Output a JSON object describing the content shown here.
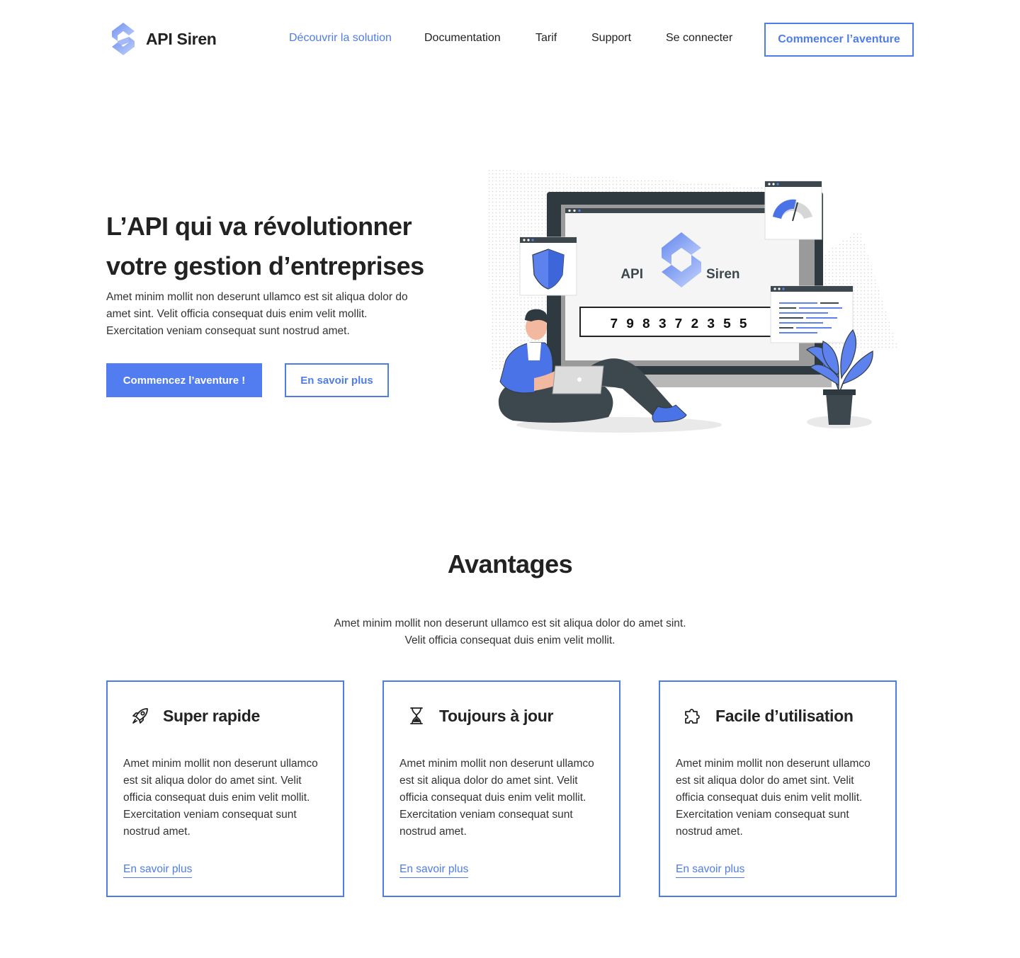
{
  "brand": {
    "name": "API Siren"
  },
  "nav": {
    "items": [
      {
        "label": "Découvrir la solution",
        "active": true
      },
      {
        "label": "Documentation"
      },
      {
        "label": "Tarif"
      },
      {
        "label": "Support"
      },
      {
        "label": "Se connecter"
      }
    ],
    "cta": "Commencer l’aventure"
  },
  "hero": {
    "title_line1": "L’API qui va révolutionner",
    "title_line2": "votre gestion d’entreprises",
    "description": "Amet minim mollit non deserunt ullamco est sit aliqua dolor do amet sint. Velit officia consequat duis enim velit mollit. Exercitation veniam consequat sunt nostrud amet.",
    "primary_button": "Commencez l’aventure !",
    "secondary_button": "En savoir plus",
    "illustration": {
      "screen_logo_left": "API",
      "screen_logo_right": "Siren",
      "siren_number": "7 9 8 3 7 2 3 5 5"
    }
  },
  "advantages": {
    "title": "Avantages",
    "description_line1": "Amet minim mollit non deserunt ullamco est sit aliqua dolor do amet sint.",
    "description_line2": "Velit officia consequat duis enim velit mollit.",
    "cards": [
      {
        "icon": "rocket-icon",
        "title": "Super rapide",
        "body": "Amet minim mollit non deserunt ullamco est sit aliqua dolor do amet sint. Velit officia consequat duis enim velit mollit. Exercitation veniam consequat sunt nostrud amet.",
        "link": "En savoir plus"
      },
      {
        "icon": "hourglass-icon",
        "title": "Toujours à jour",
        "body": "Amet minim mollit non deserunt ullamco est sit aliqua dolor do amet sint. Velit officia consequat duis enim velit mollit. Exercitation veniam consequat sunt nostrud amet.",
        "link": "En savoir plus"
      },
      {
        "icon": "puzzle-icon",
        "title": "Facile d’utilisation",
        "body": "Amet minim mollit non deserunt ullamco est sit aliqua dolor do amet sint. Velit officia consequat duis enim velit mollit. Exercitation veniam consequat sunt nostrud amet.",
        "link": "En savoir plus"
      }
    ]
  },
  "colors": {
    "accent": "#4f7de8",
    "button": "#527df0",
    "text": "#222222"
  }
}
